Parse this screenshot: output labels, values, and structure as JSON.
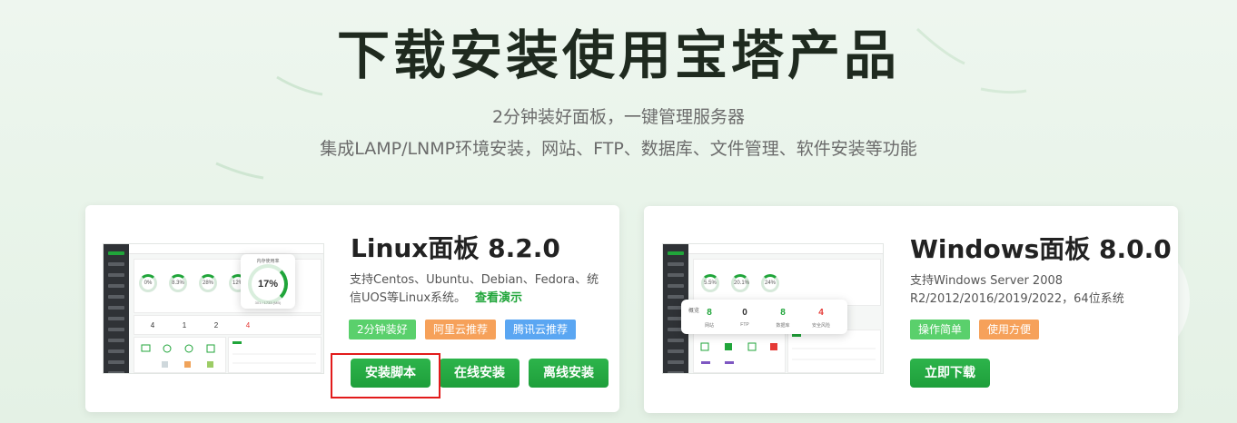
{
  "header": {
    "title": "下载安装使用宝塔产品",
    "subtitle_line1": "2分钟装好面板，一键管理服务器",
    "subtitle_line2": "集成LAMP/LNMP环境安装，网站、FTP、数据库、文件管理、软件安装等功能"
  },
  "linux": {
    "title": "Linux面板 8.2.0",
    "desc": "支持Centos、Ubuntu、Debian、Fedora、统信UOS等Linux系统。",
    "demo_link": "查看演示",
    "tags": [
      "2分钟装好",
      "阿里云推荐",
      "腾讯云推荐"
    ],
    "buttons": {
      "script": "安装脚本",
      "online": "在线安装",
      "offline": "离线安装"
    },
    "screenshot": {
      "rings": [
        "0%",
        "8.3%",
        "28%",
        "12%"
      ],
      "stats": [
        "4",
        "1",
        "2",
        "4"
      ],
      "popup_title": "内存使用率",
      "popup_value": "17%",
      "popup_detail": "301 / 1733 (MB)"
    }
  },
  "windows": {
    "title": "Windows面板 8.0.0",
    "desc_line1": "支持Windows Server 2008",
    "desc_line2": "R2/2012/2016/2019/2022，64位系统",
    "tags": [
      "操作简单",
      "使用方便"
    ],
    "buttons": {
      "download": "立即下载"
    },
    "screenshot": {
      "rings": [
        "5.5%",
        "20.1%",
        "24%"
      ],
      "popup_title": "概览",
      "stats": [
        {
          "value": "8",
          "label": "网站"
        },
        {
          "value": "0",
          "label": "FTP"
        },
        {
          "value": "8",
          "label": "数据库"
        },
        {
          "value": "4",
          "label": "安全风险"
        }
      ]
    }
  },
  "colors": {
    "brand": "#20a53a",
    "highlight": "#e21b1b"
  }
}
